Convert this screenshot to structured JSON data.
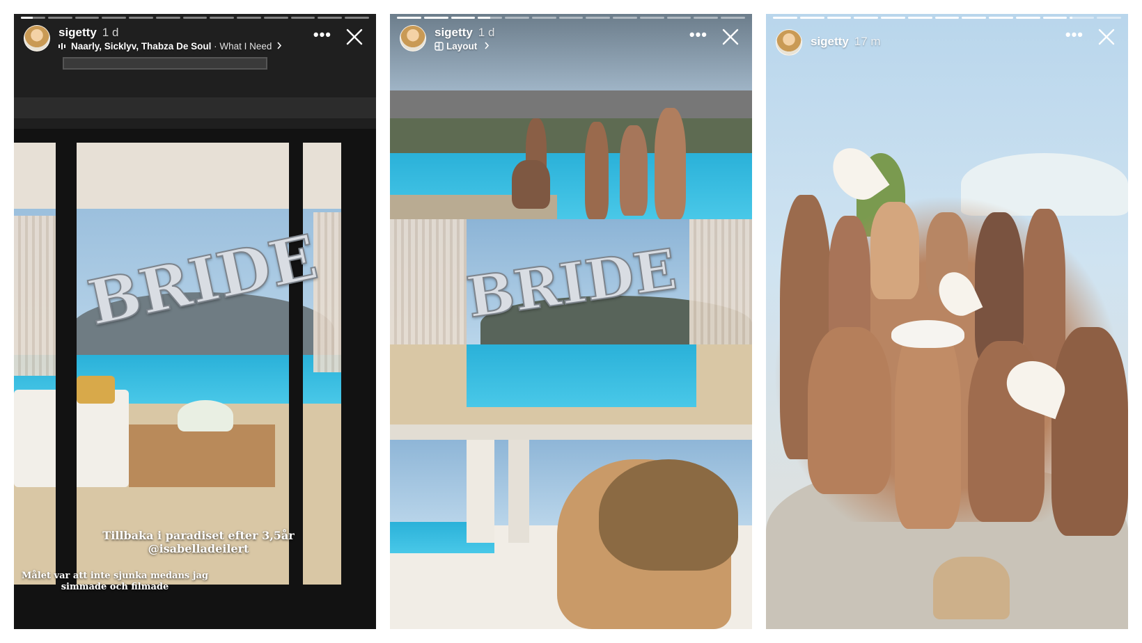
{
  "stories": [
    {
      "username": "sigetty",
      "time": "1 d",
      "music_artists": "Naarly, Sicklуv, Thabza De Soul",
      "music_separator": " · ",
      "music_track": "What I Need",
      "more_label": "•••",
      "progress": {
        "segments": 13,
        "active_index": 0,
        "active_fraction": 0.5
      },
      "balloon_text": "BRIDE",
      "caption_main_line1": "Tillbaka i paradiset efter 3,5år",
      "caption_main_line2": "@isabelladeilert",
      "caption_bottom_line1": "Målet var att inte sjunka medans jag",
      "caption_bottom_line2": "simmade och filmade"
    },
    {
      "username": "sigetty",
      "time": "1 d",
      "layout_label": "Layout",
      "more_label": "•••",
      "progress": {
        "segments": 13,
        "active_index": 3,
        "active_fraction": 0.5
      },
      "balloon_text": "BRIDE"
    },
    {
      "username": "sigetty",
      "time": "17 m",
      "more_label": "•••",
      "progress": {
        "segments": 13,
        "active_index": 11,
        "active_fraction": 0.1
      }
    }
  ],
  "colors": {
    "text": "#ffffff",
    "pool": "#38bfe3",
    "sky": "#a9c9e3"
  },
  "icons": {
    "music": "music-icon",
    "layout": "layout-icon",
    "more": "more-icon",
    "close": "close-icon",
    "chevron": "chevron-right-icon"
  }
}
